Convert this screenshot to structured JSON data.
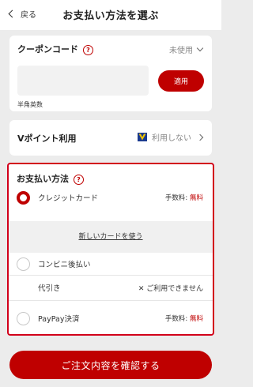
{
  "header": {
    "back_label": "戻る",
    "title": "お支払い方法を選ぶ"
  },
  "coupon": {
    "label": "クーポンコード",
    "help_icon": "?",
    "status": "未使用",
    "input_value": "",
    "input_placeholder": "",
    "apply_label": "適用",
    "hint": "半角英数"
  },
  "vpoint": {
    "label": "Vポイント利用",
    "status": "利用しない"
  },
  "payment": {
    "label": "お支払い方法",
    "help_icon": "?",
    "new_card_link": "新しいカードを使う",
    "options": [
      {
        "name": "クレジットカード",
        "fee_prefix": "手数料:",
        "fee_value": "無料",
        "selected": true
      },
      {
        "name": "コンビニ後払い",
        "selected": false
      },
      {
        "name": "代引き",
        "note": "✕ ご利用できません"
      },
      {
        "name": "PayPay決済",
        "fee_prefix": "手数料:",
        "fee_value": "無料",
        "selected": false
      }
    ]
  },
  "confirm_label": "ご注文内容を確認する",
  "colors": {
    "accent": "#bf0000",
    "background": "#ececec"
  },
  "icons": {
    "back": "chevron-left-icon",
    "coupon_toggle": "chevron-down-icon",
    "vpoint_nav": "chevron-right-icon",
    "vpoint_brand": "v-point-logo-icon"
  }
}
